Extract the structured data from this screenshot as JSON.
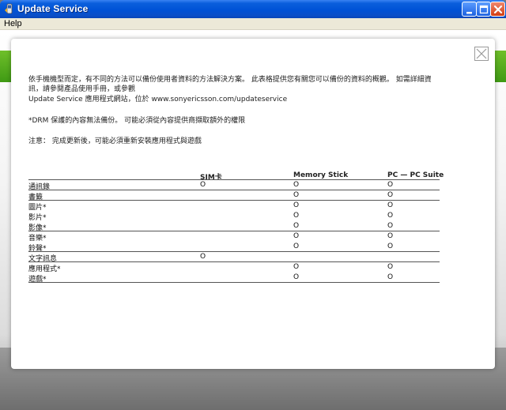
{
  "window": {
    "title": "Update Service",
    "icon": "app-icon",
    "controls": [
      "minimize-icon",
      "maximize-icon",
      "close-icon"
    ],
    "colors": {
      "titlebar": "#0052d6",
      "close": "#d23d12",
      "accent_green": "#3f9a14"
    }
  },
  "menu": {
    "help": "Help"
  },
  "dialog": {
    "close_icon": "close-icon",
    "intro_line1": "依手機機型而定，有不同的方法可以備份使用者資料的方法解決方案。 此表格提供您有關您可以備份的資料的概觀。 如需詳細資",
    "intro_line2": "訊，請參閱產品使用手冊，或參觀",
    "intro_line3": "Update Service 應用程式網站，位於 www.sonyericsson.com/updateservice",
    "drm_note": "*DRM 保護的內容無法備份。 可能必須從內容提供商擷取額外的權限",
    "notice": "注意： 完成更新後，可能必須重新安裝應用程式與遊戲",
    "table": {
      "headers": [
        "SIM卡",
        "Memory Stick",
        "PC — PC Suite"
      ],
      "mark": "O",
      "rows": [
        {
          "label": "通訊錄",
          "sim": "O",
          "ms": "O",
          "pc": "O"
        },
        {
          "label": "書籤",
          "sim": "",
          "ms": "O",
          "pc": "O"
        },
        {
          "label": "圖片*",
          "sim": "",
          "ms": "O",
          "pc": "O"
        },
        {
          "label": "影片*",
          "sim": "",
          "ms": "O",
          "pc": "O"
        },
        {
          "label": "影像*",
          "sim": "",
          "ms": "O",
          "pc": "O"
        },
        {
          "label": "音樂*",
          "sim": "",
          "ms": "O",
          "pc": "O"
        },
        {
          "label": "鈴聲*",
          "sim": "",
          "ms": "O",
          "pc": "O"
        },
        {
          "label": "文字訊息",
          "sim": "O",
          "ms": "",
          "pc": ""
        },
        {
          "label": "應用程式*",
          "sim": "",
          "ms": "O",
          "pc": "O"
        },
        {
          "label": "遊戲*",
          "sim": "",
          "ms": "O",
          "pc": "O"
        }
      ]
    }
  }
}
